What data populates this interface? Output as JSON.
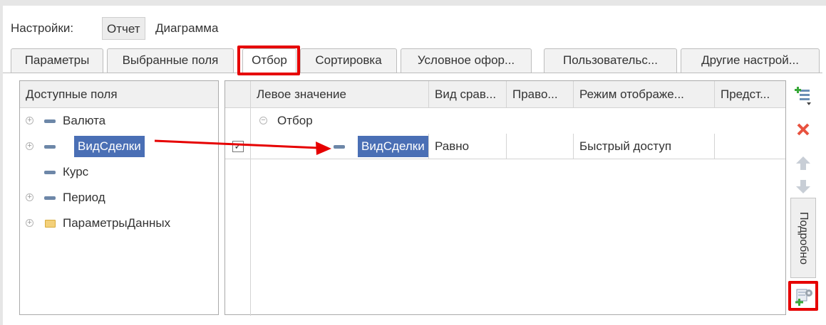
{
  "settings": {
    "label": "Настройки:",
    "report": "Отчет",
    "diagram": "Диаграмма"
  },
  "tabs": [
    {
      "label": "Параметры"
    },
    {
      "label": "Выбранные поля"
    },
    {
      "label": "Отбор"
    },
    {
      "label": "Сортировка"
    },
    {
      "label": "Условное офор..."
    },
    {
      "label": "Пользовательс..."
    },
    {
      "label": "Другие настрой..."
    }
  ],
  "active_tab": "Отбор",
  "available_fields": {
    "header": "Доступные поля",
    "items": [
      {
        "label": "Валюта",
        "expandable": true,
        "icon": "field-icon"
      },
      {
        "label": "ВидСделки",
        "expandable": true,
        "icon": "field-icon",
        "selected": true
      },
      {
        "label": "Курс",
        "expandable": false,
        "icon": "field-icon"
      },
      {
        "label": "Период",
        "expandable": true,
        "icon": "field-icon"
      },
      {
        "label": "ПараметрыДанных",
        "expandable": true,
        "icon": "folder-icon"
      }
    ]
  },
  "filter_table": {
    "columns": [
      "Левое значение",
      "Вид срав...",
      "Право...",
      "Режим отображе...",
      "Предст..."
    ],
    "group": {
      "label": "Отбор",
      "icon": "collapse-icon"
    },
    "rows": [
      {
        "checked": true,
        "left": "ВидСделки",
        "comparison": "Равно",
        "right": "",
        "mode": "Быстрый доступ",
        "repr": ""
      }
    ]
  },
  "side_toolbar": {
    "buttons": [
      "add-condition-icon",
      "delete-icon",
      "move-up-icon",
      "move-down-icon"
    ],
    "details_label": "Подробно",
    "bottom_button": "settings-add-icon"
  },
  "colors": {
    "highlight": "#e60000",
    "selection": "#4a6fb5",
    "arrow": "#e60000"
  }
}
